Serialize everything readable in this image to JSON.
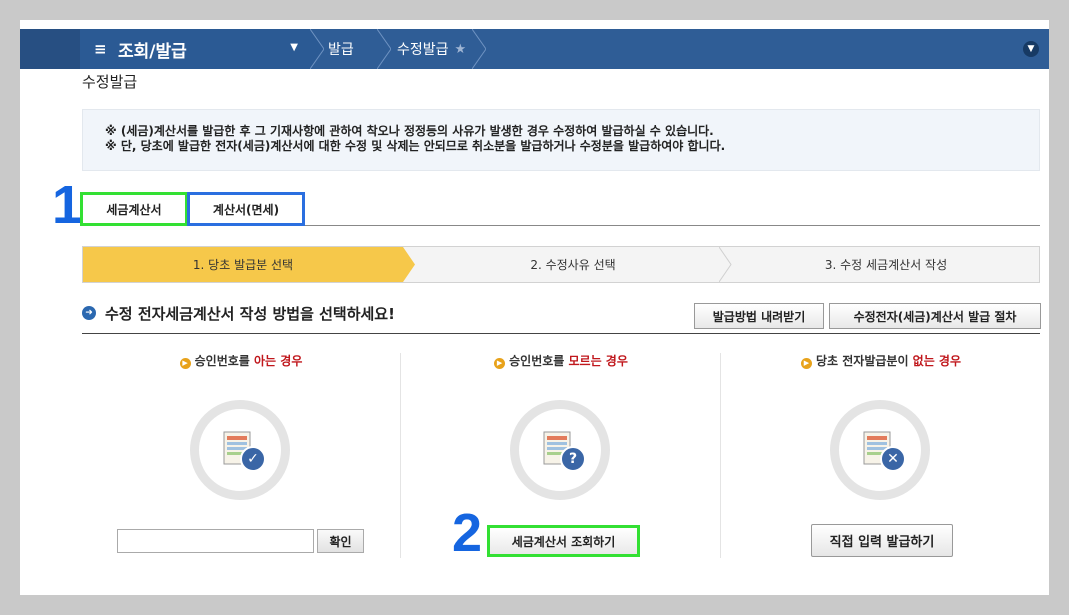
{
  "nav": {
    "menu_title": "조회/발급",
    "breadcrumbs": [
      "발급",
      "수정발급"
    ]
  },
  "page_title": "수정발급",
  "notice": {
    "line1": "※ (세금)계산서를 발급한 후 그 기재사항에 관하여 착오나 정정등의 사유가 발생한 경우 수정하여 발급하실 수 있습니다.",
    "line2": "※ 단, 당초에 발급한 전자(세금)계산서에 대한 수정 및 삭제는 안되므로 취소분을 발급하거나 수정분을 발급하여야 합니다."
  },
  "tabs": [
    {
      "label": "세금계산서"
    },
    {
      "label": "계산서(면세)"
    }
  ],
  "markers": [
    "1",
    "2"
  ],
  "steps": [
    "1. 당초 발급분 선택",
    "2. 수정사유 선택",
    "3. 수정 세금계산서 작성"
  ],
  "section": {
    "heading": "수정 전자세금계산서 작성 방법을 선택하세요!",
    "download_button": "발급방법 내려받기",
    "procedure_button": "수정전자(세금)계산서 발급 절차"
  },
  "options": [
    {
      "title_prefix": "승인번호를",
      "title_highlight": "아는 경우",
      "title_suffix": ""
    },
    {
      "title_prefix": "승인번호를",
      "title_highlight": "모르는 경우",
      "title_suffix": ""
    },
    {
      "title_prefix": "당초 전자발급분이",
      "title_highlight": "없는 경우",
      "title_suffix": ""
    }
  ],
  "approval_input": {
    "value": "",
    "placeholder": ""
  },
  "confirm_button": "확인",
  "lookup_button": "세금계산서 조회하기",
  "direct_button": "직접 입력 발급하기",
  "colors": {
    "nav": "#2f5d96",
    "active_step": "#f6c84a",
    "highlight_green": "#33e033",
    "highlight_blue": "#2a6fe0",
    "marker_blue": "#1565e0",
    "emphasis_red": "#c0171c"
  }
}
